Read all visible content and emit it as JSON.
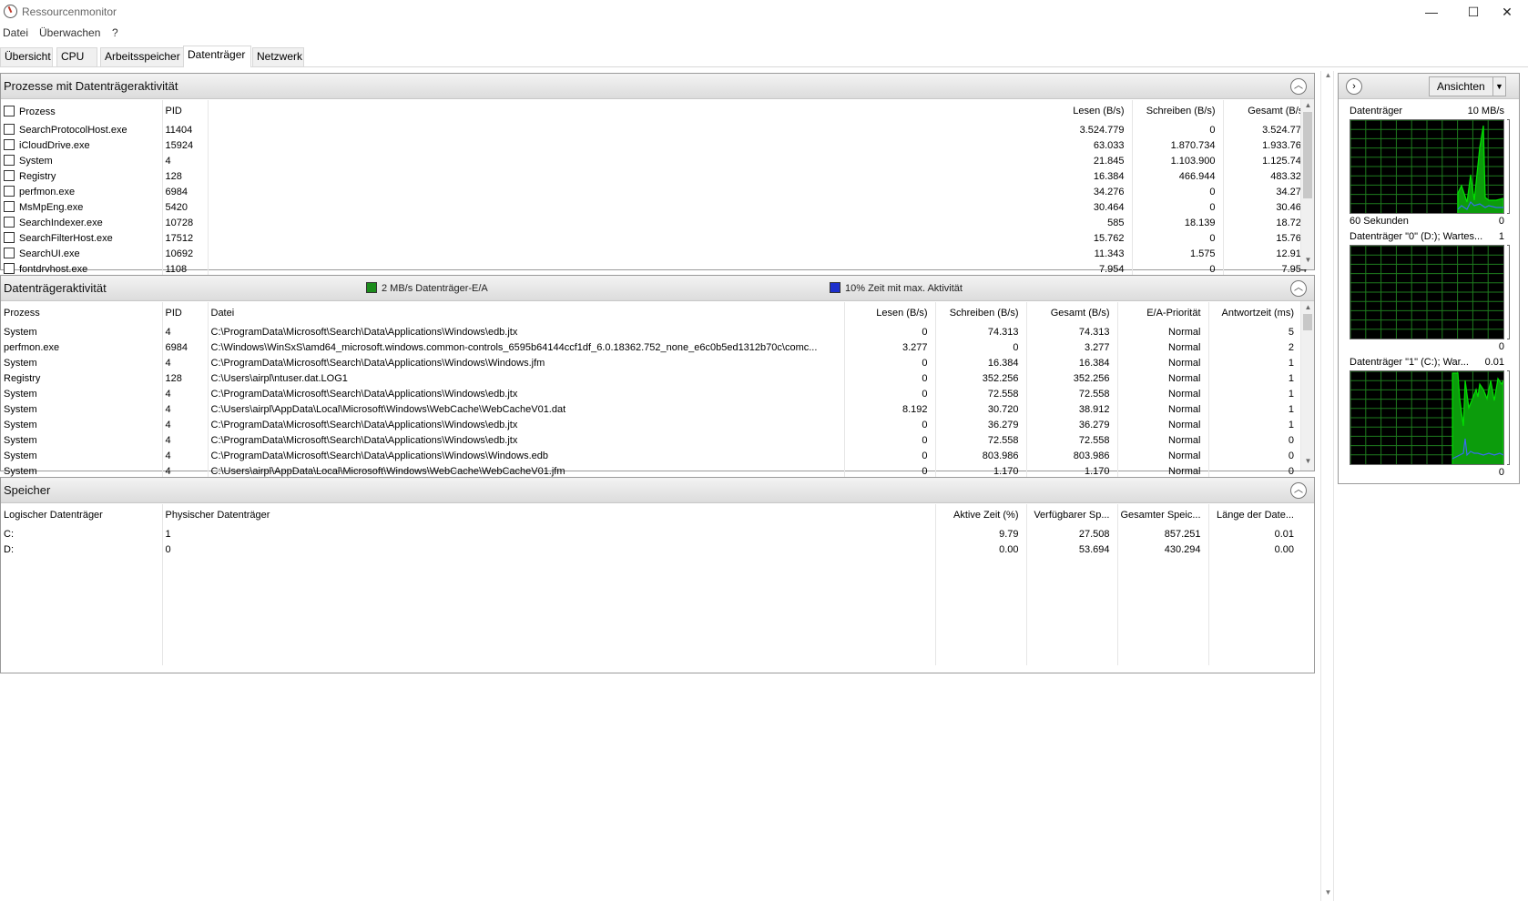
{
  "window": {
    "title": "Ressourcenmonitor",
    "min_glyph": "—",
    "max_glyph": "☐",
    "close_glyph": "✕"
  },
  "menu": [
    "Datei",
    "Überwachen",
    "?"
  ],
  "tabs": [
    {
      "label": "Übersicht",
      "active": false
    },
    {
      "label": "CPU",
      "active": false
    },
    {
      "label": "Arbeitsspeicher",
      "active": false
    },
    {
      "label": "Datenträger",
      "active": true
    },
    {
      "label": "Netzwerk",
      "active": false
    }
  ],
  "processes_panel": {
    "title": "Prozesse mit Datenträgeraktivität",
    "columns": {
      "process": "Prozess",
      "pid": "PID",
      "read": "Lesen (B/s)",
      "write": "Schreiben (B/s)",
      "total": "Gesamt (B/s)"
    },
    "rows": [
      {
        "name": "SearchProtocolHost.exe",
        "pid": "11404",
        "read": "3.524.779",
        "write": "0",
        "total": "3.524.779"
      },
      {
        "name": "iCloudDrive.exe",
        "pid": "15924",
        "read": "63.033",
        "write": "1.870.734",
        "total": "1.933.767"
      },
      {
        "name": "System",
        "pid": "4",
        "read": "21.845",
        "write": "1.103.900",
        "total": "1.125.746"
      },
      {
        "name": "Registry",
        "pid": "128",
        "read": "16.384",
        "write": "466.944",
        "total": "483.328"
      },
      {
        "name": "perfmon.exe",
        "pid": "6984",
        "read": "34.276",
        "write": "0",
        "total": "34.276"
      },
      {
        "name": "MsMpEng.exe",
        "pid": "5420",
        "read": "30.464",
        "write": "0",
        "total": "30.464"
      },
      {
        "name": "SearchIndexer.exe",
        "pid": "10728",
        "read": "585",
        "write": "18.139",
        "total": "18.725"
      },
      {
        "name": "SearchFilterHost.exe",
        "pid": "17512",
        "read": "15.762",
        "write": "0",
        "total": "15.762"
      },
      {
        "name": "SearchUI.exe",
        "pid": "10692",
        "read": "11.343",
        "write": "1.575",
        "total": "12.918"
      },
      {
        "name": "fontdrvhost.exe",
        "pid": "1108",
        "read": "7.954",
        "write": "0",
        "total": "7.954"
      }
    ]
  },
  "disk_activity_panel": {
    "title": "Datenträgeraktivität",
    "legend_green": "2 MB/s Datenträger-E/A",
    "legend_blue": "10% Zeit mit max. Aktivität",
    "columns": {
      "process": "Prozess",
      "pid": "PID",
      "file": "Datei",
      "read": "Lesen (B/s)",
      "write": "Schreiben (B/s)",
      "total": "Gesamt (B/s)",
      "priority": "E/A-Priorität",
      "response": "Antwortzeit (ms)"
    },
    "rows": [
      {
        "process": "System",
        "pid": "4",
        "file": "C:\\ProgramData\\Microsoft\\Search\\Data\\Applications\\Windows\\edb.jtx",
        "read": "0",
        "write": "74.313",
        "total": "74.313",
        "priority": "Normal",
        "response": "5"
      },
      {
        "process": "perfmon.exe",
        "pid": "6984",
        "file": "C:\\Windows\\WinSxS\\amd64_microsoft.windows.common-controls_6595b64144ccf1df_6.0.18362.752_none_e6c0b5ed1312b70c\\comc...",
        "read": "3.277",
        "write": "0",
        "total": "3.277",
        "priority": "Normal",
        "response": "2"
      },
      {
        "process": "System",
        "pid": "4",
        "file": "C:\\ProgramData\\Microsoft\\Search\\Data\\Applications\\Windows\\Windows.jfm",
        "read": "0",
        "write": "16.384",
        "total": "16.384",
        "priority": "Normal",
        "response": "1"
      },
      {
        "process": "Registry",
        "pid": "128",
        "file": "C:\\Users\\airpl\\ntuser.dat.LOG1",
        "read": "0",
        "write": "352.256",
        "total": "352.256",
        "priority": "Normal",
        "response": "1"
      },
      {
        "process": "System",
        "pid": "4",
        "file": "C:\\ProgramData\\Microsoft\\Search\\Data\\Applications\\Windows\\edb.jtx",
        "read": "0",
        "write": "72.558",
        "total": "72.558",
        "priority": "Normal",
        "response": "1"
      },
      {
        "process": "System",
        "pid": "4",
        "file": "C:\\Users\\airpl\\AppData\\Local\\Microsoft\\Windows\\WebCache\\WebCacheV01.dat",
        "read": "8.192",
        "write": "30.720",
        "total": "38.912",
        "priority": "Normal",
        "response": "1"
      },
      {
        "process": "System",
        "pid": "4",
        "file": "C:\\ProgramData\\Microsoft\\Search\\Data\\Applications\\Windows\\edb.jtx",
        "read": "0",
        "write": "36.279",
        "total": "36.279",
        "priority": "Normal",
        "response": "1"
      },
      {
        "process": "System",
        "pid": "4",
        "file": "C:\\ProgramData\\Microsoft\\Search\\Data\\Applications\\Windows\\edb.jtx",
        "read": "0",
        "write": "72.558",
        "total": "72.558",
        "priority": "Normal",
        "response": "0"
      },
      {
        "process": "System",
        "pid": "4",
        "file": "C:\\ProgramData\\Microsoft\\Search\\Data\\Applications\\Windows\\Windows.edb",
        "read": "0",
        "write": "803.986",
        "total": "803.986",
        "priority": "Normal",
        "response": "0"
      },
      {
        "process": "System",
        "pid": "4",
        "file": "C:\\Users\\airpl\\AppData\\Local\\Microsoft\\Windows\\WebCache\\WebCacheV01.jfm",
        "read": "0",
        "write": "1.170",
        "total": "1.170",
        "priority": "Normal",
        "response": "0"
      }
    ]
  },
  "storage_panel": {
    "title": "Speicher",
    "columns": {
      "logical": "Logischer Datenträger",
      "physical": "Physischer Datenträger",
      "active_time": "Aktive Zeit (%)",
      "available": "Verfügbarer Sp...",
      "total": "Gesamter Speic...",
      "queue": "Länge der Date..."
    },
    "rows": [
      {
        "logical": "C:",
        "physical": "1",
        "active_time": "9.79",
        "available": "27.508",
        "total": "857.251",
        "queue": "0.01"
      },
      {
        "logical": "D:",
        "physical": "0",
        "active_time": "0.00",
        "available": "53.694",
        "total": "430.294",
        "queue": "0.00"
      }
    ]
  },
  "graphs_panel": {
    "views_button": "Ansichten",
    "graphs": [
      {
        "title": "Datenträger",
        "top_value": "10 MB/s",
        "footer_left": "60 Sekunden",
        "footer_right": "0"
      },
      {
        "title": "Datenträger \"0\" (D:); Wartes...",
        "top_value": "1",
        "footer_left": "",
        "footer_right": "0"
      },
      {
        "title": "Datenträger \"1\" (C:); War...",
        "top_value": "0.01",
        "footer_left": "",
        "footer_right": "0"
      }
    ],
    "colors": {
      "grid": "#1e7b1e",
      "line_green": "#00e000",
      "line_blue": "#3a6cf0",
      "fill_green": "#0c9c0c"
    }
  },
  "colors": {
    "legend_green": "#1c8c1c",
    "legend_blue": "#1d2fcc"
  }
}
